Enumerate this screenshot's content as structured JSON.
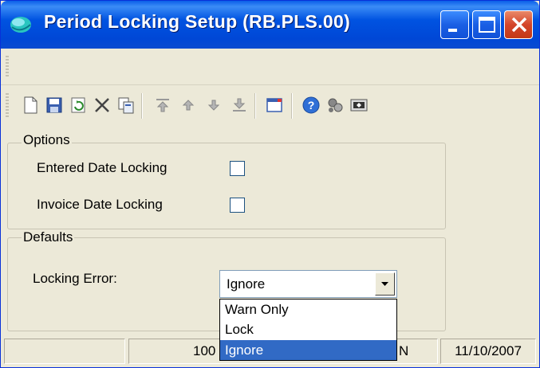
{
  "window": {
    "title": "Period Locking Setup (RB.PLS.00)"
  },
  "title_buttons": [
    "minimize-icon",
    "maximize-icon",
    "close-icon"
  ],
  "toolbar_icons": [
    "new-document-icon",
    "save-icon",
    "refresh-icon",
    "delete-icon",
    "copy-icon",
    "first-record-icon",
    "previous-record-icon",
    "next-record-icon",
    "last-record-icon",
    "window-icon",
    "help-icon",
    "customize-icon",
    "screen-icon"
  ],
  "options": {
    "legend": "Options",
    "entered_date_label": "Entered Date Locking",
    "invoice_date_label": "Invoice Date Locking",
    "entered_date_checked": false,
    "invoice_date_checked": false
  },
  "defaults": {
    "legend": "Defaults",
    "locking_error_label": "Locking Error:",
    "locking_error_value": "Ignore",
    "locking_error_options": [
      "Warn Only",
      "Lock",
      "Ignore"
    ],
    "selected_option": "Ignore"
  },
  "status": {
    "pane2_text": "100",
    "pane3_text": "N",
    "date": "11/10/2007"
  },
  "colors": {
    "titlebar": "#0053e1",
    "selection": "#316ac5",
    "face": "#ece9d8"
  }
}
